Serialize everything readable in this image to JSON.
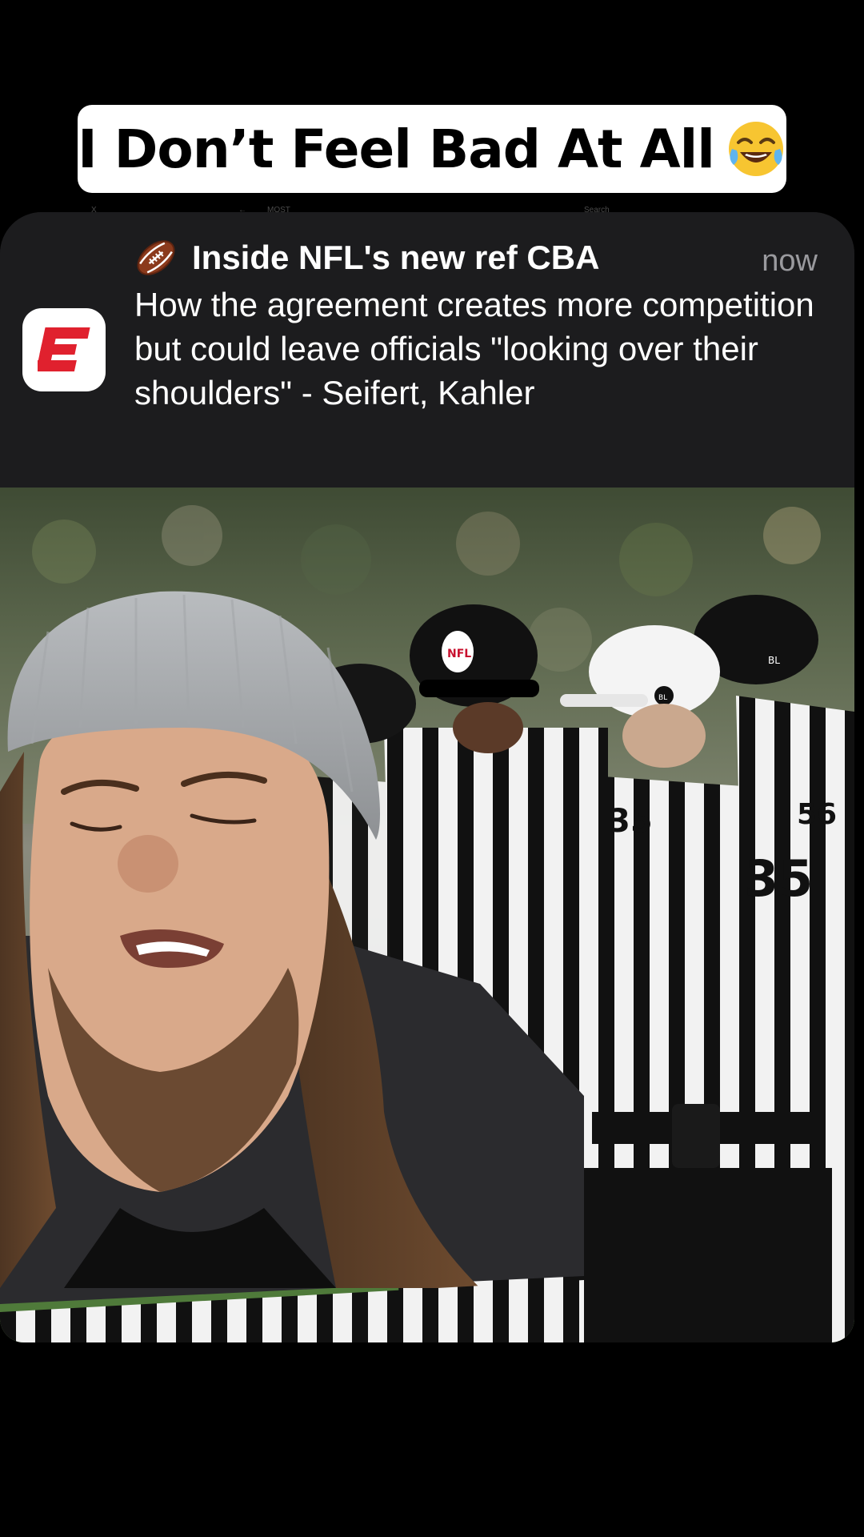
{
  "caption": {
    "text": "I Don’t Feel Bad At All",
    "emoji_icon": "tears-of-joy-emoji"
  },
  "ghost_ui": {
    "left_label": "X",
    "center_label": "MOST",
    "right_label": "Search"
  },
  "notification": {
    "app_icon": "espn-logo-icon",
    "title_icon": "american-football-icon",
    "title": "Inside NFL's new ref CBA",
    "time": "now",
    "body": "How the agreement creates more competition but could leave officials \"looking over their shoulders\" - Seifert, Kahler"
  },
  "photo": {
    "jersey_numbers": [
      "35",
      "35",
      "56"
    ],
    "cap_labels": [
      "NFL",
      "BL",
      "BL"
    ]
  },
  "colors": {
    "espn_red": "#e0212e",
    "notification_bg": "#1c1c1e",
    "caption_bg": "#ffffff"
  }
}
